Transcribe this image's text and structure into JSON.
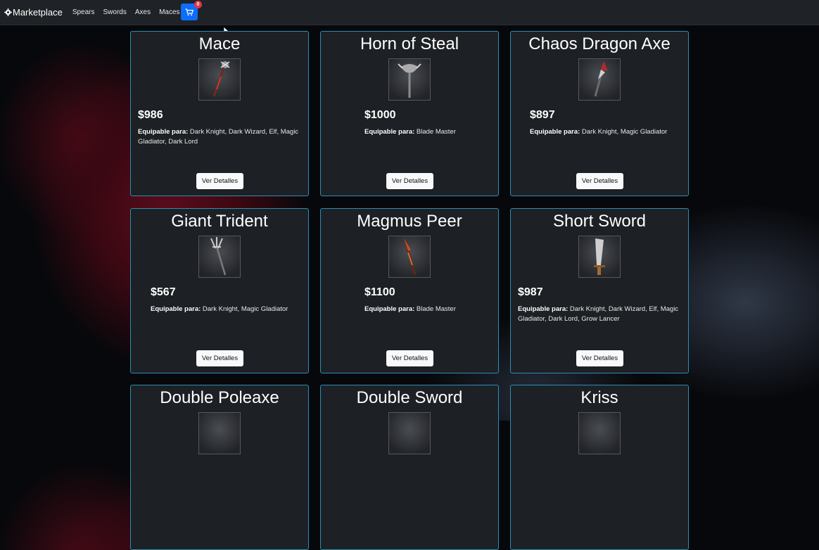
{
  "navbar": {
    "brand": "Marketplace",
    "links": [
      "Spears",
      "Swords",
      "Axes",
      "Maces"
    ],
    "cart_count": "0"
  },
  "equip_label": "Equipable para:",
  "details_label": "Ver Detalles",
  "items": [
    {
      "name": "Mace",
      "price": "$986",
      "equipable": "Dark Knight, Dark Wizard, Elf, Magic Gladiator, Dark Lord"
    },
    {
      "name": "Horn of Steal",
      "price": "$1000",
      "equipable": "Blade Master"
    },
    {
      "name": "Chaos Dragon Axe",
      "price": "$897",
      "equipable": "Dark Knight, Magic Gladiator"
    },
    {
      "name": "Giant Trident",
      "price": "$567",
      "equipable": "Dark Knight, Magic Gladiator"
    },
    {
      "name": "Magmus Peer",
      "price": "$1100",
      "equipable": "Blade Master"
    },
    {
      "name": "Short Sword",
      "price": "$987",
      "equipable": "Dark Knight, Dark Wizard, Elf, Magic Gladiator, Dark Lord, Grow Lancer"
    },
    {
      "name": "Double Poleaxe"
    },
    {
      "name": "Double Sword"
    },
    {
      "name": "Kriss"
    }
  ],
  "colors": {
    "accent": "#0d6efd",
    "card_border": "#2a8fb5",
    "badge": "#dc3545"
  }
}
